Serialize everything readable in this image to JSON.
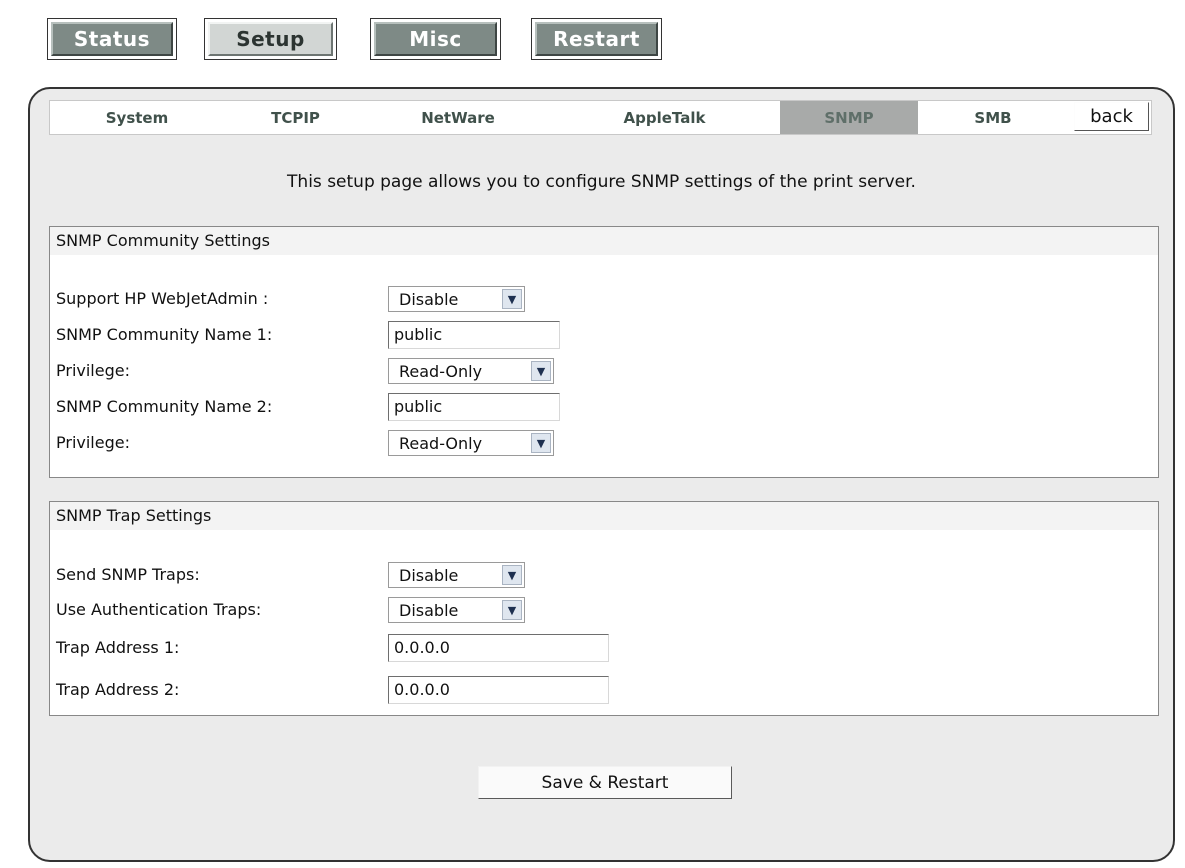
{
  "top_nav": {
    "status": "Status",
    "setup": "Setup",
    "misc": "Misc",
    "restart": "Restart"
  },
  "tabs": [
    {
      "label": "System"
    },
    {
      "label": "TCPIP"
    },
    {
      "label": "NetWare"
    },
    {
      "label": "AppleTalk"
    },
    {
      "label": "SNMP",
      "active": true
    },
    {
      "label": "SMB"
    }
  ],
  "back_label": "back",
  "intro_text": "This setup page allows you to configure SNMP settings of the print server.",
  "community": {
    "header": "SNMP Community Settings",
    "webjetadmin_label": "Support HP WebJetAdmin :",
    "webjetadmin_value": "Disable",
    "name1_label": "SNMP Community Name 1:",
    "name1_value": "public",
    "privilege1_label": "Privilege:",
    "privilege1_value": "Read-Only",
    "name2_label": "SNMP Community Name 2:",
    "name2_value": "public",
    "privilege2_label": "Privilege:",
    "privilege2_value": "Read-Only"
  },
  "trap": {
    "header": "SNMP Trap Settings",
    "send_label": "Send SNMP Traps:",
    "send_value": "Disable",
    "auth_label": "Use Authentication Traps:",
    "auth_value": "Disable",
    "addr1_label": "Trap Address 1:",
    "addr1_value": "0.0.0.0",
    "addr2_label": "Trap Address 2:",
    "addr2_value": "0.0.0.0"
  },
  "save_label": "Save & Restart",
  "colors": {
    "active_tab": "#a8aaa9",
    "nav_dark": "#7e8a86",
    "panel_bg": "#ebebeb"
  },
  "icons": {
    "dropdown": "chevron-down-icon"
  }
}
